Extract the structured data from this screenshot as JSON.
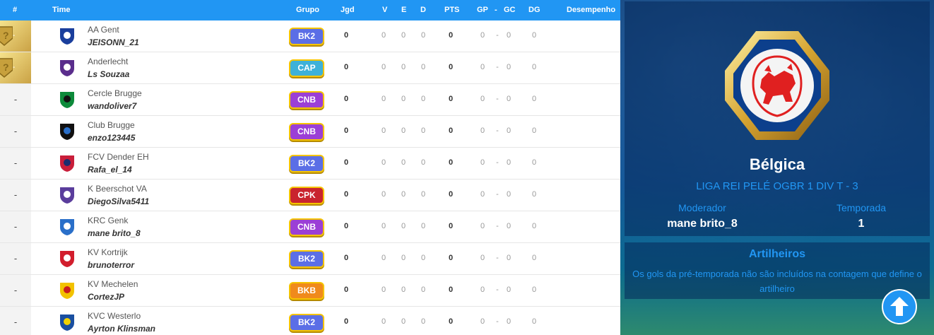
{
  "headers": {
    "rank": "#",
    "team": "Time",
    "group": "Grupo",
    "played": "Jgd",
    "wins": "V",
    "draws": "E",
    "losses": "D",
    "points": "PTS",
    "goals_for": "GP",
    "sep": "-",
    "goals_against": "GC",
    "goal_diff": "DG",
    "performance": "Desempenho"
  },
  "rows": [
    {
      "rank": "-",
      "team": "AA Gent",
      "user": "JEISONN_21",
      "group": "BK2",
      "group_color": "#5b6ee6",
      "jgd": "0",
      "v": "0",
      "e": "0",
      "d": "0",
      "pts": "0",
      "gp": "0",
      "sep": "-",
      "gc": "0",
      "dg": "0",
      "medal": true
    },
    {
      "rank": "-",
      "team": "Anderlecht",
      "user": "Ls Souzaa",
      "group": "CAP",
      "group_color": "#3db1d9",
      "jgd": "0",
      "v": "0",
      "e": "0",
      "d": "0",
      "pts": "0",
      "gp": "0",
      "sep": "-",
      "gc": "0",
      "dg": "0",
      "medal": true
    },
    {
      "rank": "-",
      "team": "Cercle Brugge",
      "user": "wandoliver7",
      "group": "CNB",
      "group_color": "#9b3fd6",
      "jgd": "0",
      "v": "0",
      "e": "0",
      "d": "0",
      "pts": "0",
      "gp": "0",
      "sep": "-",
      "gc": "0",
      "dg": "0",
      "medal": false
    },
    {
      "rank": "-",
      "team": "Club Brugge",
      "user": "enzo123445",
      "group": "CNB",
      "group_color": "#9b3fd6",
      "jgd": "0",
      "v": "0",
      "e": "0",
      "d": "0",
      "pts": "0",
      "gp": "0",
      "sep": "-",
      "gc": "0",
      "dg": "0",
      "medal": false
    },
    {
      "rank": "-",
      "team": "FCV Dender EH",
      "user": "Rafa_el_14",
      "group": "BK2",
      "group_color": "#5b6ee6",
      "jgd": "0",
      "v": "0",
      "e": "0",
      "d": "0",
      "pts": "0",
      "gp": "0",
      "sep": "-",
      "gc": "0",
      "dg": "0",
      "medal": false
    },
    {
      "rank": "-",
      "team": "K Beerschot VA",
      "user": "DiegoSilva5411",
      "group": "CPK",
      "group_color": "#c9242e",
      "jgd": "0",
      "v": "0",
      "e": "0",
      "d": "0",
      "pts": "0",
      "gp": "0",
      "sep": "-",
      "gc": "0",
      "dg": "0",
      "medal": false
    },
    {
      "rank": "-",
      "team": "KRC Genk",
      "user": "mane brito_8",
      "group": "CNB",
      "group_color": "#9b3fd6",
      "jgd": "0",
      "v": "0",
      "e": "0",
      "d": "0",
      "pts": "0",
      "gp": "0",
      "sep": "-",
      "gc": "0",
      "dg": "0",
      "medal": false
    },
    {
      "rank": "-",
      "team": "KV Kortrijk",
      "user": "brunoterror",
      "group": "BK2",
      "group_color": "#5b6ee6",
      "jgd": "0",
      "v": "0",
      "e": "0",
      "d": "0",
      "pts": "0",
      "gp": "0",
      "sep": "-",
      "gc": "0",
      "dg": "0",
      "medal": false
    },
    {
      "rank": "-",
      "team": "KV Mechelen",
      "user": "CortezJP",
      "group": "BKB",
      "group_color": "#f08a1c",
      "jgd": "0",
      "v": "0",
      "e": "0",
      "d": "0",
      "pts": "0",
      "gp": "0",
      "sep": "-",
      "gc": "0",
      "dg": "0",
      "medal": false
    },
    {
      "rank": "-",
      "team": "KVC Westerlo",
      "user": "Ayrton Klinsman",
      "group": "BK2",
      "group_color": "#5b6ee6",
      "jgd": "0",
      "v": "0",
      "e": "0",
      "d": "0",
      "pts": "0",
      "gp": "0",
      "sep": "-",
      "gc": "0",
      "dg": "0",
      "medal": false
    }
  ],
  "league": {
    "name": "Bélgica",
    "subtitle": "LIGA REI PELÉ OGBR 1 DIV T - 3",
    "moderator_label": "Moderador",
    "moderator": "mane brito_8",
    "season_label": "Temporada",
    "season": "1"
  },
  "scorers": {
    "title": "Artilheiros",
    "note": "Os gols da pré-temporada não são incluídos na contagem que define o artilheiro"
  },
  "colors": {
    "header_blue": "#2196f3",
    "badge_border": "#f5c400",
    "panel_bg": "#0b4f8f"
  },
  "icons": {
    "scroll_top": "arrow-up-icon",
    "league_logo": "red-bull-emblem-icon"
  }
}
